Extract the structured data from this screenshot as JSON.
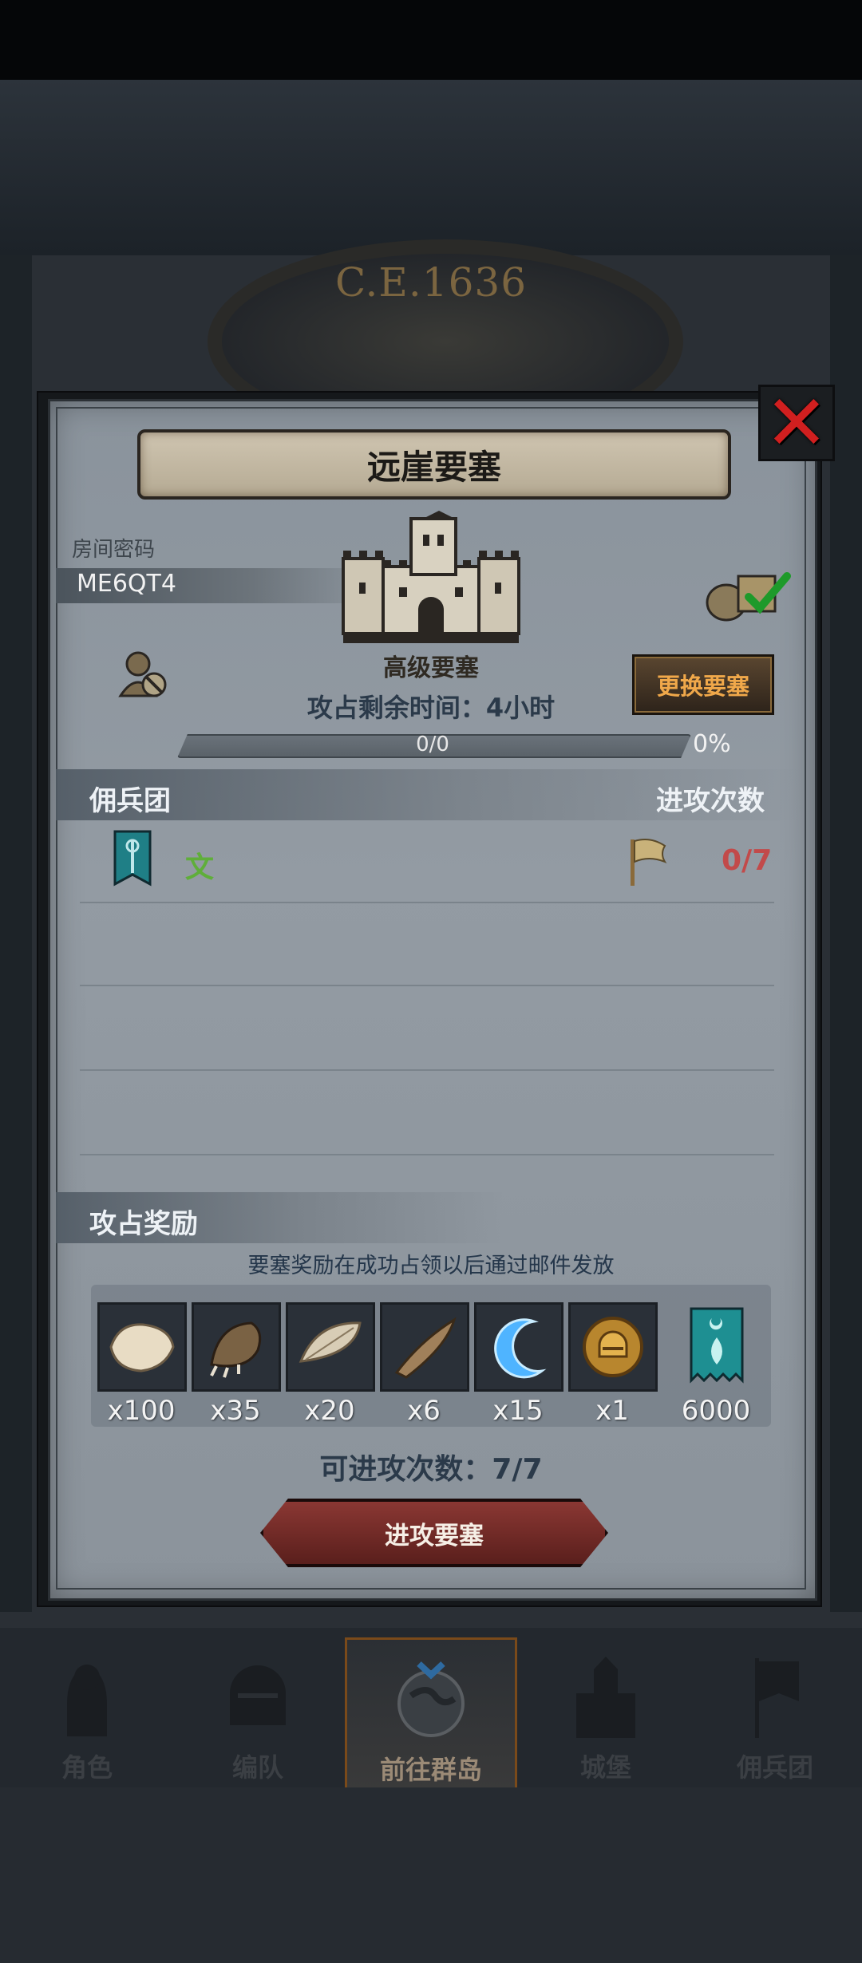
{
  "background": {
    "era_label": "C.E.1636"
  },
  "dialog": {
    "title": "远崖要塞",
    "room_code_label": "房间密码",
    "room_code": "ME6QT4",
    "fortress_type": "高级要塞",
    "change_fortress_label": "更换要塞",
    "remaining_time": "攻占剩余时间：4小时",
    "progress": {
      "text": "0/0",
      "percent": "0%",
      "fraction": 0
    },
    "mercenary_section_title": "佣兵团",
    "attack_count_header": "进攻次数",
    "mercenary_rows": [
      {
        "name": "文",
        "attacks": "0/7",
        "banner_icon": "teal-guild-banner-icon"
      }
    ],
    "rewards_section_title": "攻占奖励",
    "rewards_note": "要塞奖励在成功占领以后通过邮件发放",
    "rewards": [
      {
        "icon": "fur-pelt-icon",
        "qty": "x100"
      },
      {
        "icon": "beast-claw-icon",
        "qty": "x35"
      },
      {
        "icon": "feather-fur-icon",
        "qty": "x20"
      },
      {
        "icon": "horn-icon",
        "qty": "x6"
      },
      {
        "icon": "blue-crescent-icon",
        "qty": "x15"
      },
      {
        "icon": "gold-helmet-coin-icon",
        "qty": "x1"
      },
      {
        "icon": "guild-banner-currency-icon",
        "qty": "6000"
      }
    ],
    "attacks_available": "可进攻次数：7/7",
    "attack_button_label": "进攻要塞"
  },
  "bottom_nav": [
    {
      "label": "角色",
      "icon": "knight-icon",
      "active": false
    },
    {
      "label": "编队",
      "icon": "helmet-icon",
      "active": false
    },
    {
      "label": "前往群岛",
      "icon": "globe-icon",
      "active": true
    },
    {
      "label": "城堡",
      "icon": "castle-icon",
      "active": false
    },
    {
      "label": "佣兵团",
      "icon": "mercenary-banner-icon",
      "active": false
    }
  ],
  "colors": {
    "panel": "#939ba3",
    "close_x": "#d11f1f",
    "guild_name": "#5fae3a",
    "attack_count": "#c24a4a",
    "change_button_text": "#f0a84a",
    "attack_button": "#8a3733"
  }
}
